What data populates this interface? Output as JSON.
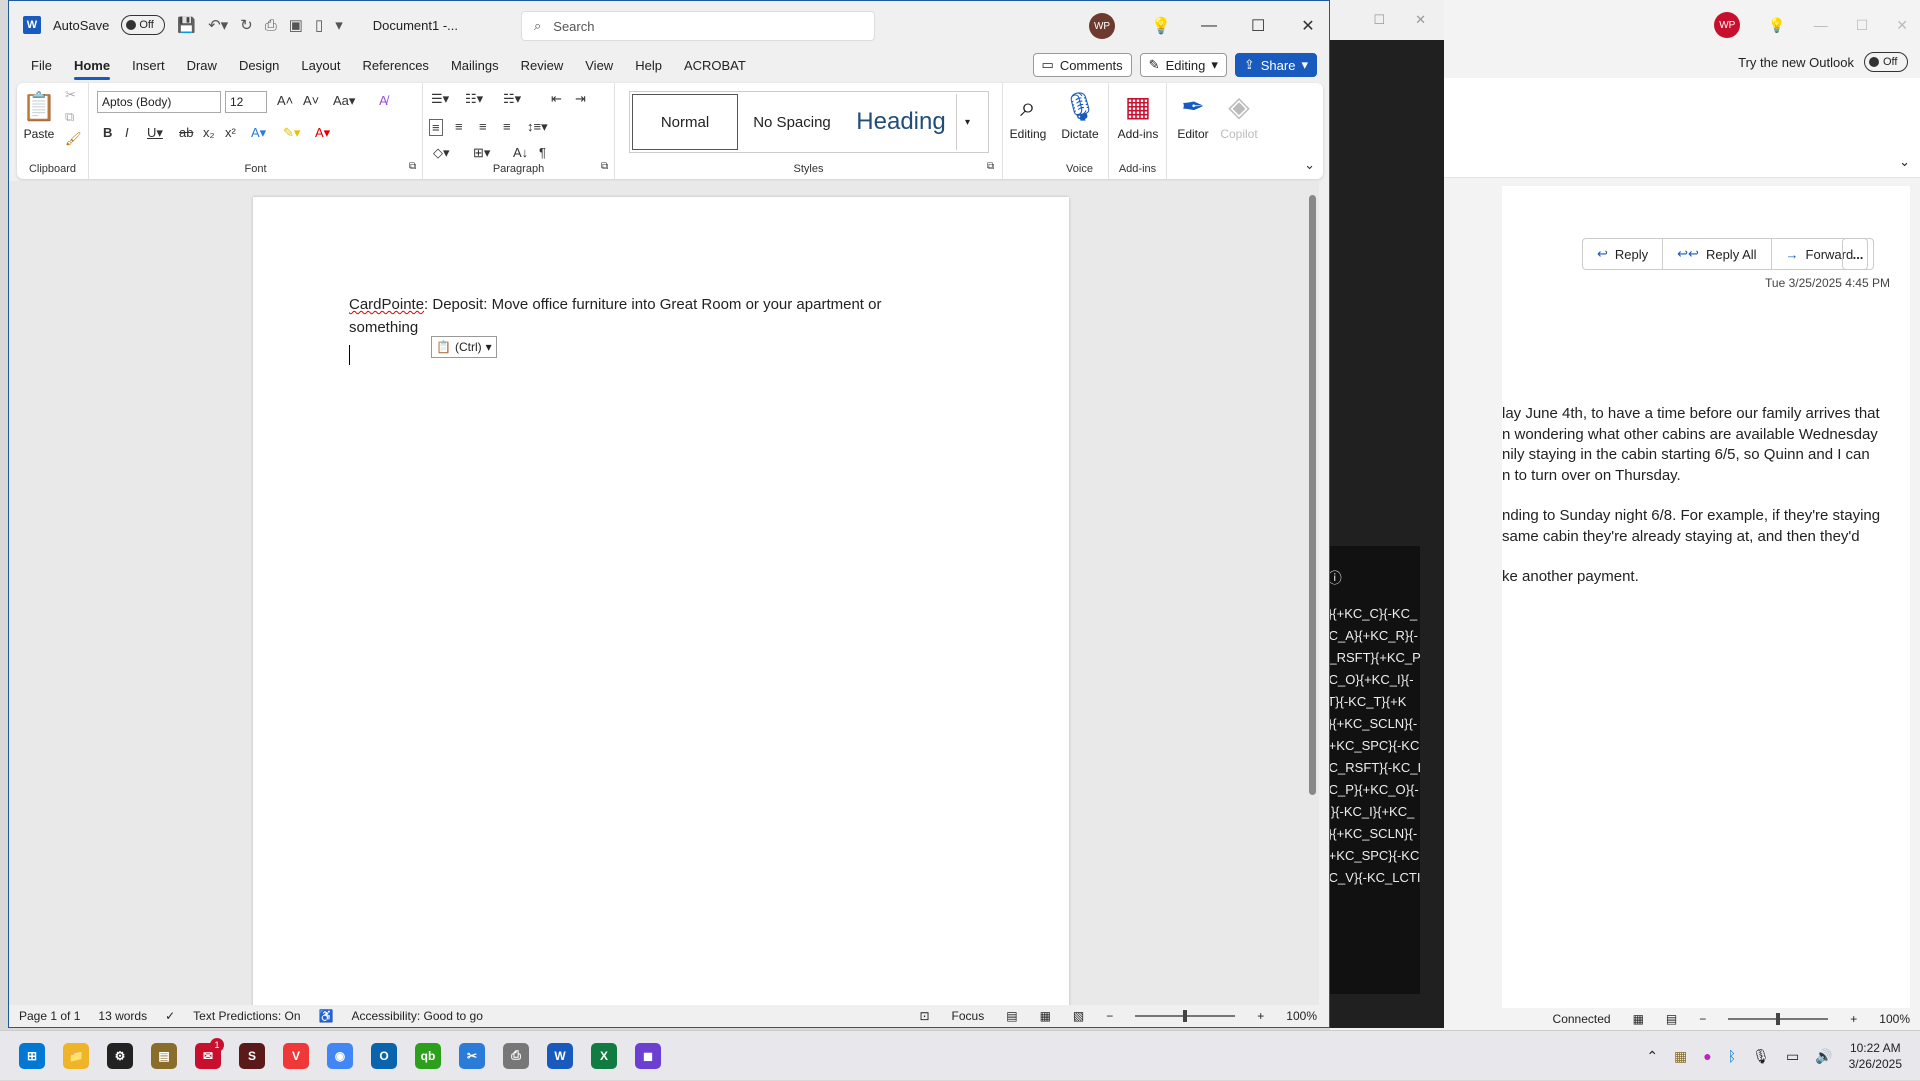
{
  "outlook": {
    "avatar": "WP",
    "try_label": "Try the new Outlook",
    "toggle_label": "Off",
    "more_dots": "ooo",
    "actions": [
      {
        "icon": "↩",
        "label": "Reply"
      },
      {
        "icon": "↩↩",
        "label": "Reply All"
      },
      {
        "icon": "→",
        "label": "Forward"
      }
    ],
    "more": "...",
    "date": "Tue 3/25/2025 4:45 PM",
    "body": [
      "lay June 4th, to have a time before our family arrives that",
      "n wondering what other cabins are available Wednesday",
      "nily staying in the cabin starting 6/5, so Quinn and I can",
      "n to turn over on Thursday.",
      "nding to Sunday night 6/8. For example, if they're staying",
      " same cabin they're already staying at, and then they'd",
      "ke another payment."
    ],
    "status_connected": "Connected",
    "zoom": "100%"
  },
  "dark_panel": {
    "header": "t ⓘ",
    "lines": [
      "T}{+KC_C}{-KC_",
      "KC_A}{+KC_R}{-",
      "C_RSFT}{+KC_P",
      "KC_O}{+KC_I}{-",
      "_T}{-KC_T}{+K",
      "T}{+KC_SCLN}{-",
      "}{+KC_SPC}{-KC",
      "KC_RSFT}{-KC_I",
      "KC_P}{+KC_O}{-",
      "_I}{-KC_I}{+KC_",
      "T}{+KC_SCLN}{-",
      "}{+KC_SPC}{-KC",
      "KC_V}{-KC_LCTI"
    ]
  },
  "word": {
    "autosave_label": "AutoSave",
    "autosave_state": "Off",
    "doc_name": "Document1  -...",
    "search_placeholder": "Search",
    "avatar": "WP",
    "tabs": [
      "File",
      "Home",
      "Insert",
      "Draw",
      "Design",
      "Layout",
      "References",
      "Mailings",
      "Review",
      "View",
      "Help",
      "ACROBAT"
    ],
    "comments_label": "Comments",
    "editing_label": "Editing",
    "share_label": "Share",
    "ribbon": {
      "clipboard_label": "Clipboard",
      "paste_label": "Paste",
      "font_name": "Aptos (Body)",
      "font_size": "12",
      "font_label": "Font",
      "paragraph_label": "Paragraph",
      "styles_label": "Styles",
      "style_normal": "Normal",
      "style_nospacing": "No Spacing",
      "style_heading": "Heading",
      "editing_btn": "Editing",
      "dictate_btn": "Dictate",
      "addins_btn": "Add-ins",
      "voice_label": "Voice",
      "addins_label": "Add-ins",
      "editor_btn": "Editor",
      "copilot_btn": "Copilot"
    },
    "document": {
      "misspelled": "CardPointe",
      "line": ": Deposit: Move office furniture into Great Room or your apartment or something",
      "paste_chip": "(Ctrl)"
    },
    "status": {
      "page": "Page 1 of 1",
      "words": "13 words",
      "predictions": "Text Predictions: On",
      "accessibility": "Accessibility: Good to go",
      "focus": "Focus",
      "zoom": "100%"
    }
  },
  "taskbar": {
    "icons": [
      {
        "name": "start",
        "glyph": "⊞",
        "color": "#0078d4"
      },
      {
        "name": "file-explorer",
        "glyph": "📁",
        "color": "#f0b429"
      },
      {
        "name": "chatgpt",
        "glyph": "⚙",
        "color": "#222222"
      },
      {
        "name": "library",
        "glyph": "▤",
        "color": "#8a6d2b"
      },
      {
        "name": "app-red",
        "glyph": "✉",
        "color": "#c8102e",
        "badge": "1"
      },
      {
        "name": "app-dark",
        "glyph": "S",
        "color": "#5a1a1a"
      },
      {
        "name": "vivaldi",
        "glyph": "V",
        "color": "#ef3939"
      },
      {
        "name": "chrome",
        "glyph": "◉",
        "color": "#4285f4"
      },
      {
        "name": "outlook",
        "glyph": "O",
        "color": "#0a64ad"
      },
      {
        "name": "quickbooks",
        "glyph": "qb",
        "color": "#2ca01c"
      },
      {
        "name": "snipping-tool",
        "glyph": "✂",
        "color": "#2b7bd8"
      },
      {
        "name": "printer",
        "glyph": "⎙",
        "color": "#777777"
      },
      {
        "name": "word",
        "glyph": "W",
        "color": "#185abd"
      },
      {
        "name": "excel",
        "glyph": "X",
        "color": "#107c41"
      },
      {
        "name": "app-purple",
        "glyph": "◼",
        "color": "#6a3fd1"
      }
    ],
    "time": "10:22 AM",
    "date": "3/26/2025"
  }
}
